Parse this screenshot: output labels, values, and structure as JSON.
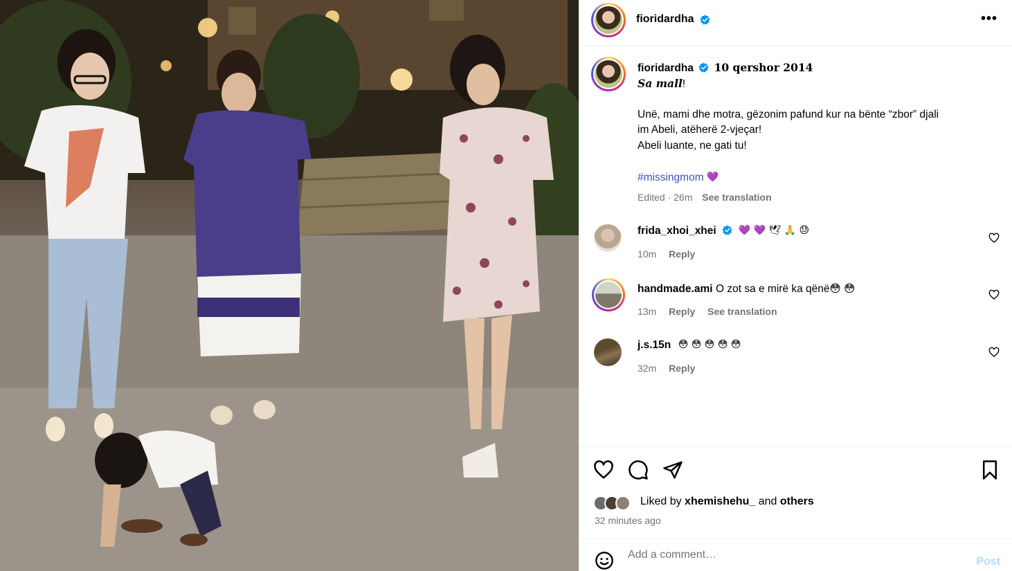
{
  "header": {
    "username": "fioridardha",
    "more_label": "•••"
  },
  "caption": {
    "username": "fioridardha",
    "date_title": "10 qershor 2014",
    "headline_bold": "Sa mall",
    "headline_end": "!",
    "line1": "Unë, mami dhe motra, gëzonim pafund kur na bënte “zbor” djali",
    "line2": "im Abeli, atëherë 2-vjeçar!",
    "line3": "Abeli luante, ne gati tu!",
    "hashtag": "#missingmom",
    "hashtag_emoji": "💜",
    "edited": "Edited · 26m",
    "see_translation": "See translation"
  },
  "comments": [
    {
      "username": "frida_xhoi_xhei",
      "text": "💜 💜 🕊 🙏 😓",
      "time": "10m",
      "reply": "Reply"
    },
    {
      "username": "handmade.ami",
      "text": "O zot sa e mirë ka qënë😳 😳",
      "time": "13m",
      "reply": "Reply",
      "see_translation": "See translation"
    },
    {
      "username": "j.s.15n",
      "text": "😳 😳 😳 😳 😳",
      "time": "32m",
      "reply": "Reply"
    }
  ],
  "likes": {
    "prefix": "Liked by ",
    "user": "xhemishehu_",
    "mid": " and ",
    "others": "others",
    "ago": "32 minutes ago"
  },
  "comment_box": {
    "placeholder": "Add a comment…",
    "post_label": "Post"
  },
  "colors": {
    "verified": "#0095f6",
    "link": "#4150c7",
    "muted": "#737373",
    "post_disabled": "#b3dbff"
  }
}
